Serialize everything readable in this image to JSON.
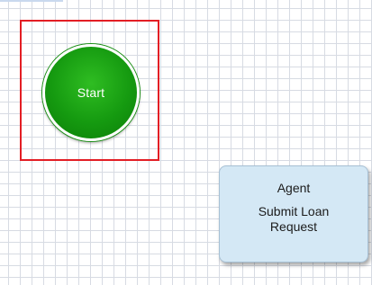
{
  "diagram": {
    "start_event": {
      "label": "Start",
      "color": "#159a10",
      "selected": true
    },
    "task": {
      "type_label": "Agent",
      "name": "Submit Loan Request",
      "fill_color": "#d4e8f5"
    },
    "selection_color": "#e31e24"
  }
}
